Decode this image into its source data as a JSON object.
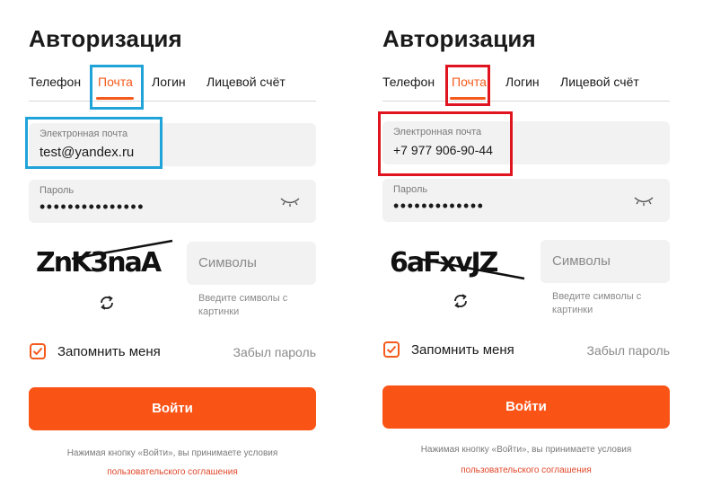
{
  "panels": [
    {
      "title": "Авторизация",
      "tabs": [
        "Телефон",
        "Почта",
        "Логин",
        "Лицевой счёт"
      ],
      "active_tab": "Почта",
      "email_label": "Электронная почта",
      "email_value": "test@yandex.ru",
      "password_label": "Пароль",
      "password_dots": "•••••••••••••••",
      "captcha_text": "ZnK3naA",
      "symbols_placeholder": "Символы",
      "captcha_hint": "Введите символы с картинки",
      "remember_label": "Запомнить меня",
      "remember_checked": true,
      "forgot_label": "Забыл пароль",
      "login_label": "Войти",
      "terms_text": "Нажимая кнопку «Войти», вы принимаете условия",
      "terms_link": "пользовательского соглашения",
      "highlight_color": "#1fa3d8"
    },
    {
      "title": "Авторизация",
      "tabs": [
        "Телефон",
        "Почта",
        "Логин",
        "Лицевой счёт"
      ],
      "active_tab": "Почта",
      "email_label": "Электронная почта",
      "email_value": "+7 977 906-90-44",
      "password_label": "Пароль",
      "password_dots": "•••••••••••••",
      "captcha_text": "6aFxvJZ",
      "symbols_placeholder": "Символы",
      "captcha_hint": "Введите символы с картинки",
      "remember_label": "Запомнить меня",
      "remember_checked": true,
      "forgot_label": "Забыл пароль",
      "login_label": "Войти",
      "terms_text": "Нажимая кнопку «Войти», вы принимаете условия",
      "terms_link": "пользовательского соглашения",
      "highlight_color": "#e0141e"
    }
  ],
  "colors": {
    "accent": "#fa5316",
    "field_bg": "#f2f2f2",
    "muted": "#8a8a8a"
  },
  "icons": {
    "eye": "eye-closed-icon",
    "refresh": "refresh-icon",
    "check": "check-icon"
  }
}
